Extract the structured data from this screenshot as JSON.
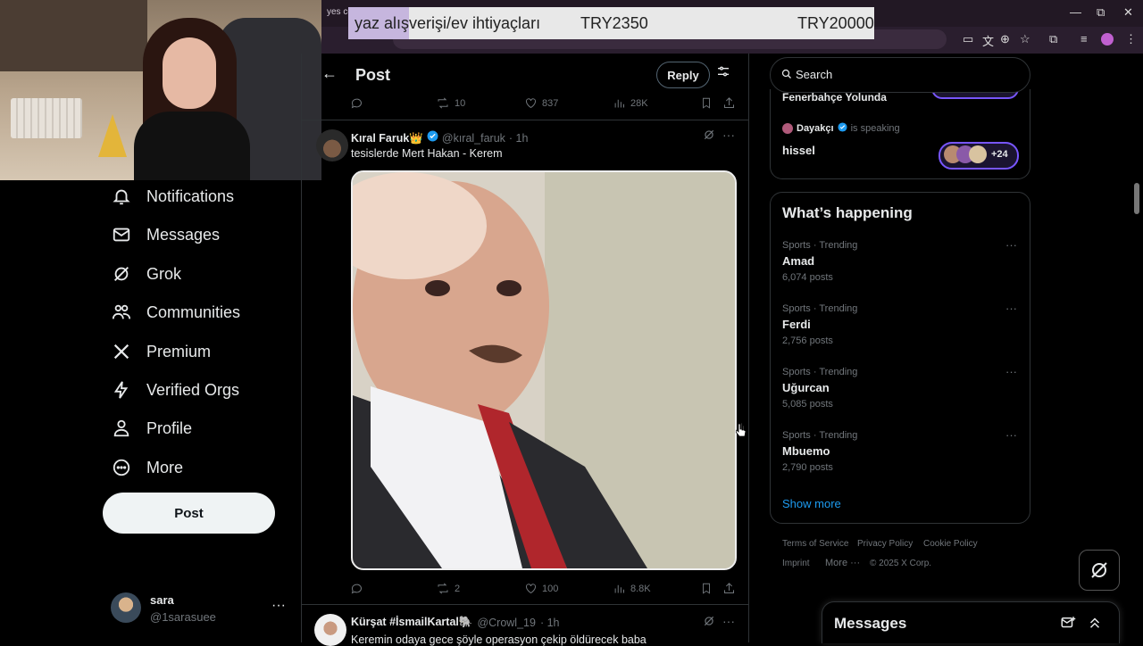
{
  "browser": {
    "tab_title": "yes co",
    "controls": {
      "minimize": "—",
      "restore": "⧉",
      "close": "✕"
    }
  },
  "donation": {
    "label": "yaz alışverişi/ev ihtiyaçları",
    "current": "TRY2350",
    "goal": "TRY20000"
  },
  "nav": {
    "items": [
      {
        "label": "Notifications",
        "icon": "bell-icon"
      },
      {
        "label": "Messages",
        "icon": "mail-icon"
      },
      {
        "label": "Grok",
        "icon": "grok-icon"
      },
      {
        "label": "Communities",
        "icon": "people-icon"
      },
      {
        "label": "Premium",
        "icon": "x-logo-icon"
      },
      {
        "label": "Verified Orgs",
        "icon": "lightning-icon"
      },
      {
        "label": "Profile",
        "icon": "person-icon"
      },
      {
        "label": "More",
        "icon": "more-circle-icon"
      }
    ],
    "post_label": "Post",
    "account": {
      "name": "sara",
      "handle": "@1sarasuee"
    }
  },
  "header": {
    "title": "Post",
    "reply_label": "Reply"
  },
  "top_actions": {
    "reposts": "10",
    "likes": "837",
    "views": "28K"
  },
  "tweet": {
    "author": "Kıral Faruk👑",
    "handle": "@kıral_faruk",
    "time": "· 1h",
    "text": "tesislerde Mert Hakan - Kerem",
    "reposts": "2",
    "likes": "100",
    "views": "8.8K"
  },
  "next_tweet": {
    "author": "Kürşat #İsmailKartal🐘",
    "handle": "@Crowl_19",
    "time": "· 1h",
    "text": "Keremin odaya gece şöyle operasyon çekip öldürecek baba"
  },
  "search": {
    "placeholder": "Search"
  },
  "spaces": {
    "top_title": "Fenerbahçe Yolunda",
    "speaker": "Dayakçı",
    "speaking": "is speaking",
    "space_title": "hissel",
    "listeners": "+24"
  },
  "trends": {
    "heading": "What’s happening",
    "items": [
      {
        "category": "Sports · Trending",
        "name": "Amad",
        "count": "6,074 posts"
      },
      {
        "category": "Sports · Trending",
        "name": "Ferdi",
        "count": "2,756 posts"
      },
      {
        "category": "Sports · Trending",
        "name": "Uğurcan",
        "count": "5,085 posts"
      },
      {
        "category": "Sports · Trending",
        "name": "Mbuemo",
        "count": "2,790 posts"
      }
    ],
    "show_more": "Show more"
  },
  "footer": {
    "terms": "Terms of Service",
    "privacy": "Privacy Policy",
    "cookie": "Cookie Policy",
    "imprint": "Imprint",
    "more": "More ···",
    "copyright": "© 2025 X Corp."
  },
  "messages_drawer": {
    "title": "Messages"
  },
  "colors": {
    "accent": "#1d9bf0",
    "spaces": "#7856ff",
    "background": "#000000"
  }
}
